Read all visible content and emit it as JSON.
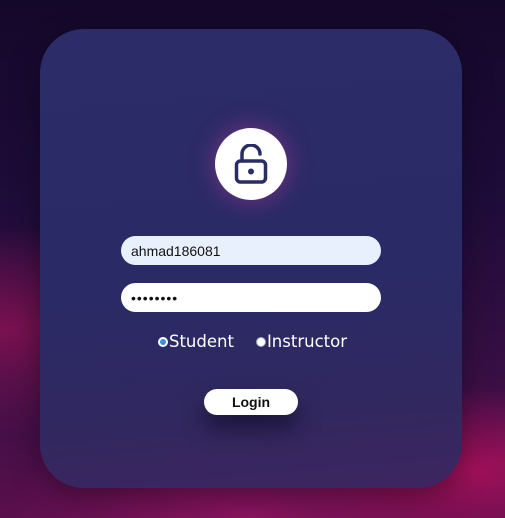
{
  "login": {
    "username_value": "ahmad186081",
    "password_value": "••••••••",
    "roles": [
      {
        "label": "Student",
        "checked": true
      },
      {
        "label": "Instructor",
        "checked": false
      }
    ],
    "submit_label": "Login"
  },
  "icons": {
    "lock": "unlock-icon"
  },
  "colors": {
    "card": "#2c2c68",
    "icon": "#2a2d64",
    "radio_selected": "#3b8fd9",
    "username_bg": "#e8f0fe",
    "background_glow": "#a3105a"
  }
}
